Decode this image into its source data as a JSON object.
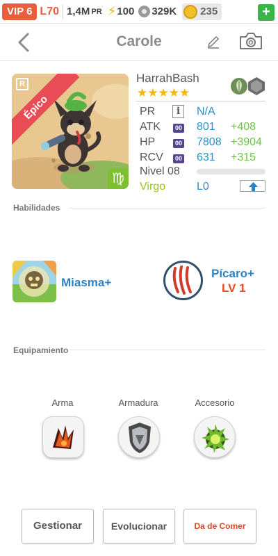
{
  "status_bar": {
    "vip": "VIP 6",
    "level": "L70",
    "pr_value": "1,4M",
    "pr_unit": "PR",
    "energy": "100",
    "paws": "329K",
    "coins": "235",
    "plus_label": "+",
    "icons": [
      "bolt-icon",
      "paw-icon",
      "coin-icon"
    ]
  },
  "header": {
    "title": "Carole",
    "icons": [
      "back-arrow-icon",
      "pencil-icon",
      "camera-icon"
    ]
  },
  "pet": {
    "rarity_letter": "R",
    "rarity_ribbon": "Épico",
    "zodiac_symbol": "♍",
    "name": "HarrahBash",
    "stars": "★★★★★",
    "star_count": 5,
    "elements": [
      "leaf-element-icon",
      "rock-element-icon"
    ],
    "stats": {
      "pr_label": "PR",
      "pr_info": "i",
      "pr_value": "N/A",
      "atk_label": "ATK",
      "atk_value": "801",
      "atk_bonus": "+408",
      "hp_label": "HP",
      "hp_value": "7808",
      "hp_bonus": "+3904",
      "rcv_label": "RCV",
      "rcv_value": "631",
      "rcv_bonus": "+315",
      "stat_tag": "00",
      "level_label": "Nivel 08",
      "level_progress": 0,
      "zodiac_label": "Virgo",
      "zodiac_level": "L0"
    },
    "colors": {
      "stat_value": "#2a8ec8",
      "stat_bonus": "#6ec348",
      "zodiac": "#9bc414",
      "ribbon": "#e84c54"
    }
  },
  "skills": {
    "section_title": "Habilidades",
    "items": [
      {
        "name": "Miasma+",
        "level": ""
      },
      {
        "name": "Pícaro+",
        "level": "LV 1"
      }
    ]
  },
  "equipment": {
    "section_title": "Equipamiento",
    "slots": [
      {
        "label": "Arma"
      },
      {
        "label": "Armadura"
      },
      {
        "label": "Accesorio"
      }
    ]
  },
  "actions": {
    "manage": "Gestionar",
    "evolve": "Evolucionar",
    "feed": "Da de Comer"
  }
}
